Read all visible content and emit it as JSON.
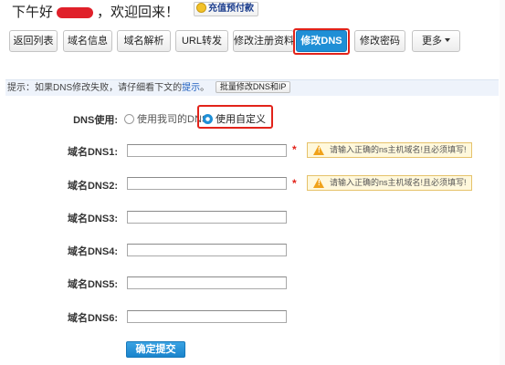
{
  "header": {
    "greeting_prefix": "下午好",
    "greeting_suffix": "，欢迎回来！",
    "recharge_label": "充值预付款"
  },
  "nav": {
    "tabs": [
      {
        "label": "返回列表"
      },
      {
        "label": "域名信息"
      },
      {
        "label": "域名解析"
      },
      {
        "label": "URL转发"
      },
      {
        "label": "修改注册资料"
      },
      {
        "label": "修改DNS",
        "active": true
      },
      {
        "label": "修改密码"
      },
      {
        "label": "更多"
      }
    ]
  },
  "hint": {
    "text": "提示：如果DNS修改失败，请仔细看下文的",
    "link": "提示",
    "suffix": "。",
    "batch_button": "批量修改DNS和IP"
  },
  "form": {
    "dns_use_label": "DNS使用:",
    "option_ours": "使用我司的DNS",
    "option_custom": "使用自定义",
    "selected": "使用自定义",
    "fields": [
      {
        "label": "域名DNS1:",
        "value": "",
        "required": true
      },
      {
        "label": "域名DNS2:",
        "value": "",
        "required": true
      },
      {
        "label": "域名DNS3:",
        "value": ""
      },
      {
        "label": "域名DNS4:",
        "value": ""
      },
      {
        "label": "域名DNS5:",
        "value": ""
      },
      {
        "label": "域名DNS6:",
        "value": ""
      }
    ],
    "required_mark": "*",
    "warning_text": "请输入正确的ns主机域名!且必须填写!",
    "submit_label": "确定提交"
  },
  "colors": {
    "accent": "#1f8fd6",
    "highlight": "#e2231a",
    "warning_bg": "#fff8dc",
    "warning_border": "#e6c26a"
  }
}
